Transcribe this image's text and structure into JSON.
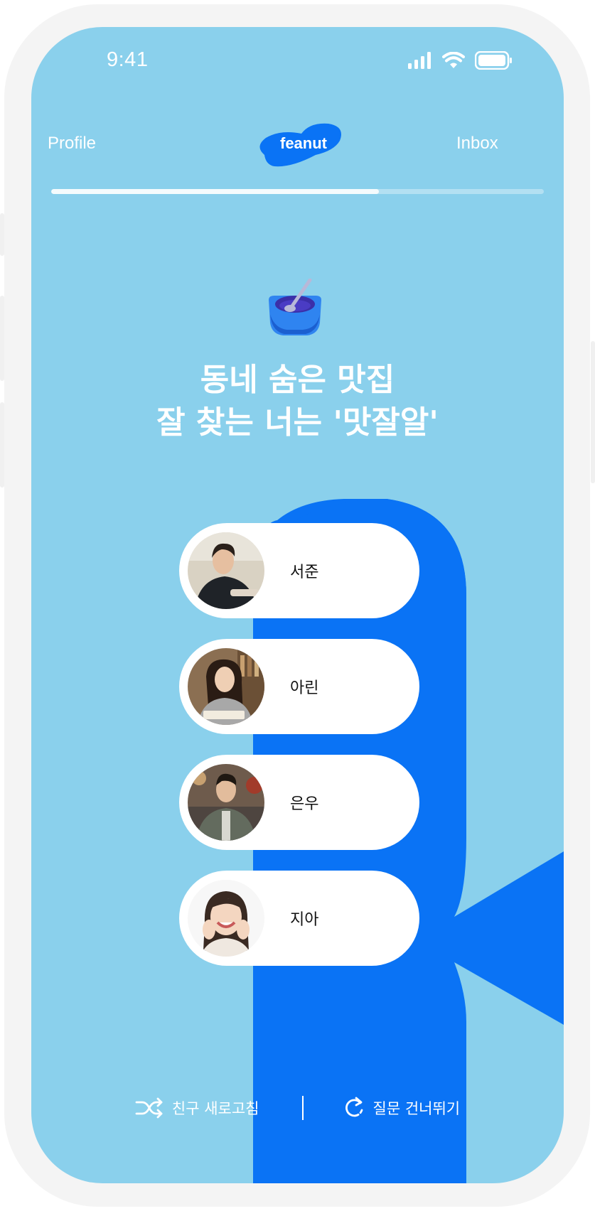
{
  "status_bar": {
    "time": "9:41"
  },
  "nav": {
    "left": "Profile",
    "center_logo": "feanut",
    "right": "Inbox"
  },
  "progress": {
    "fraction": 0.665
  },
  "question": {
    "emoji": "bowl-with-spoon",
    "line1": "동네 숨은 맛집",
    "line2": "잘 찾는 너는 '맛잘알'"
  },
  "choices": [
    {
      "name": "서준"
    },
    {
      "name": "아린"
    },
    {
      "name": "은우"
    },
    {
      "name": "지아"
    }
  ],
  "bottom": {
    "refresh_label": "친구 새로고침",
    "skip_label": "질문 건너뛰기"
  },
  "colors": {
    "background": "#8ad0ec",
    "accent": "#0a73f5",
    "text": "#ffffff"
  }
}
